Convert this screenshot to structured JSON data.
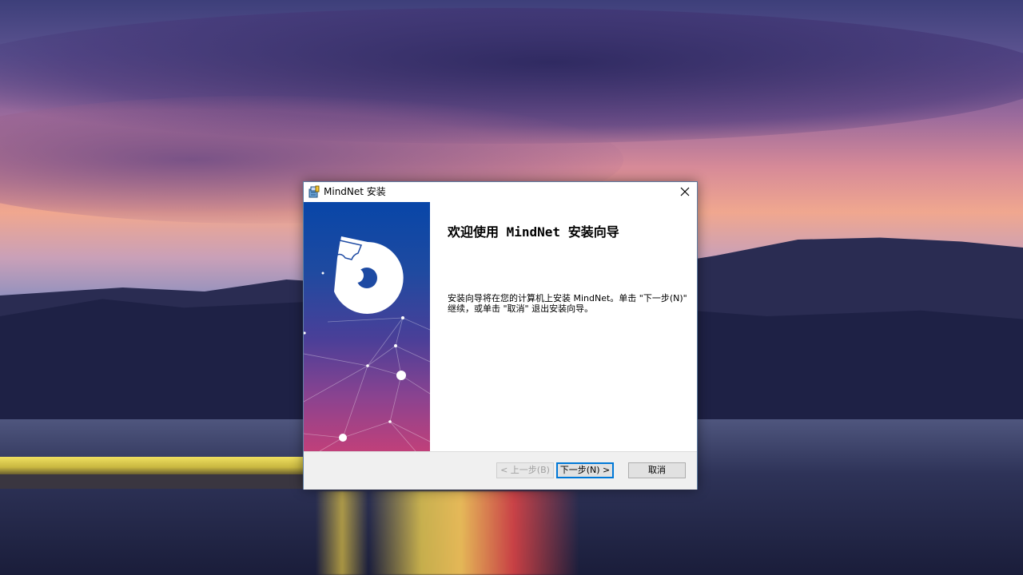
{
  "window": {
    "title": "MindNet 安装"
  },
  "content": {
    "heading": "欢迎使用 MindNet 安装向导",
    "body": "安装向导将在您的计算机上安装 MindNet。单击 \"下一步(N)\" 继续，或单击 \"取消\" 退出安装向导。"
  },
  "buttons": {
    "back": "< 上一步(B)",
    "next": "下一步(N) >",
    "cancel": "取消"
  },
  "icons": {
    "app": "installer-package-icon",
    "close": "close-icon",
    "logo": "puzzle-logo-icon"
  },
  "colors": {
    "banner_top": "#0846a8",
    "banner_bottom": "#c0407a",
    "focus": "#0078d7"
  }
}
